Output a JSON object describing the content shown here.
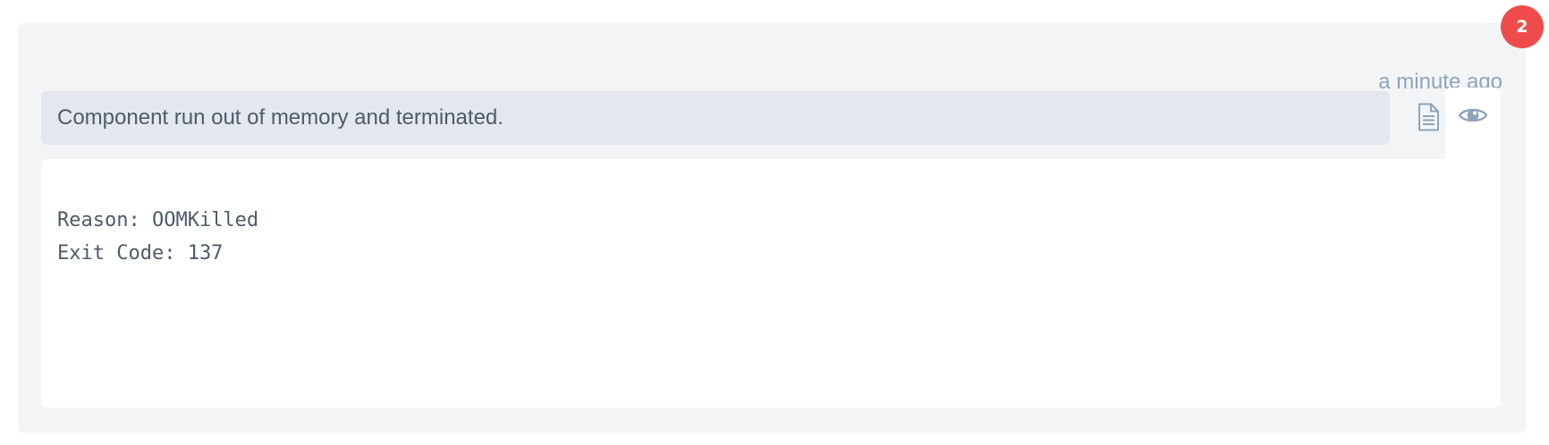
{
  "notification": {
    "count": "2",
    "timestamp": "a minute ago",
    "message": "Component run out of memory and terminated.",
    "details": {
      "reason_line": "Reason: OOMKilled",
      "exit_code_line": "Exit Code: 137"
    }
  },
  "icons": {
    "details_toggle": "document-icon",
    "view_toggle": "eye-icon"
  },
  "colors": {
    "badge": "#f04b4b",
    "card_background": "#f3f4f6",
    "message_background": "#e4e7ee",
    "text": "#4d5b6b",
    "muted": "#8fa4ba"
  }
}
